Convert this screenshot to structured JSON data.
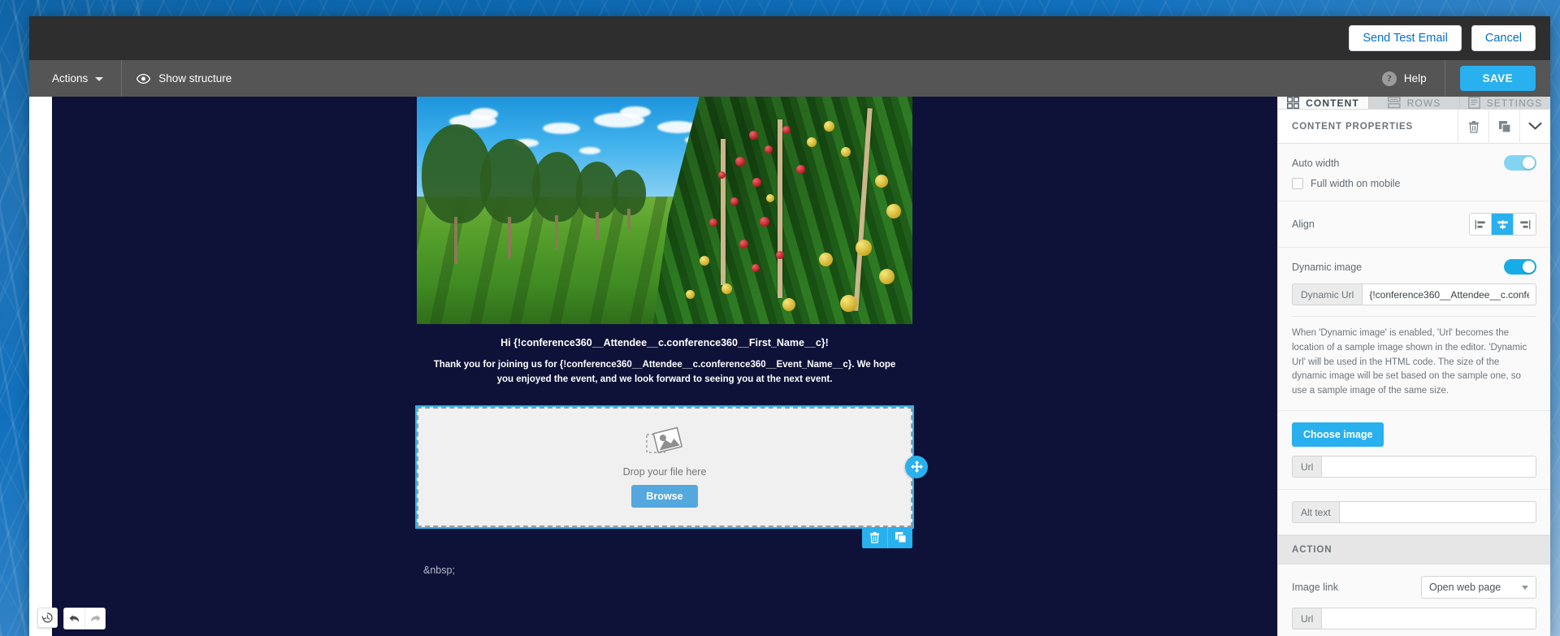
{
  "topbar": {
    "send_test_email": "Send Test Email",
    "cancel": "Cancel"
  },
  "toolbar": {
    "actions": "Actions",
    "show_structure": "Show structure",
    "help": "Help",
    "save": "SAVE"
  },
  "canvas": {
    "greeting": "Hi {!conference360__Attendee__c.conference360__First_Name__c}!",
    "body": "Thank you for joining us for {!conference360__Attendee__c.conference360__Event_Name__c}. We hope you enjoyed the event, and we look forward to seeing you at the next event.",
    "dropzone_text": "Drop your file here",
    "browse": "Browse",
    "nbsp_row": "&nbsp;"
  },
  "panel": {
    "tabs": [
      {
        "label": "CONTENT",
        "icon": "grid-icon",
        "active": true
      },
      {
        "label": "ROWS",
        "icon": "rows-icon",
        "active": false
      },
      {
        "label": "SETTINGS",
        "icon": "settings-icon",
        "active": false
      }
    ],
    "properties_title": "CONTENT PROPERTIES",
    "auto_width_label": "Auto width",
    "auto_width_on": true,
    "full_width_mobile_label": "Full width on mobile",
    "full_width_mobile_checked": false,
    "align_label": "Align",
    "align_selected": "center",
    "dynamic_image_label": "Dynamic image",
    "dynamic_image_on": true,
    "dynamic_url_label": "Dynamic Url",
    "dynamic_url_value": "{!conference360__Attendee__c.conference360",
    "help_text": "When 'Dynamic image' is enabled, 'Url' becomes the location of a sample image shown in the editor. 'Dynamic Url' will be used in the HTML code. The size of the dynamic image will be set based on the sample one, so use a sample image of the same size.",
    "choose_image": "Choose image",
    "url_label": "Url",
    "url_value": "",
    "alt_text_label": "Alt text",
    "alt_text_value": "",
    "action_section": "ACTION",
    "image_link_label": "Image link",
    "image_link_value": "Open web page",
    "action_url_label": "Url",
    "action_url_value": ""
  },
  "colors": {
    "accent_blue": "#29b0ee",
    "topbar_dark": "#2e2e2e",
    "toolbar_grey": "#555555",
    "canvas_navy": "#0e1138",
    "link_blue": "#0070d2"
  }
}
